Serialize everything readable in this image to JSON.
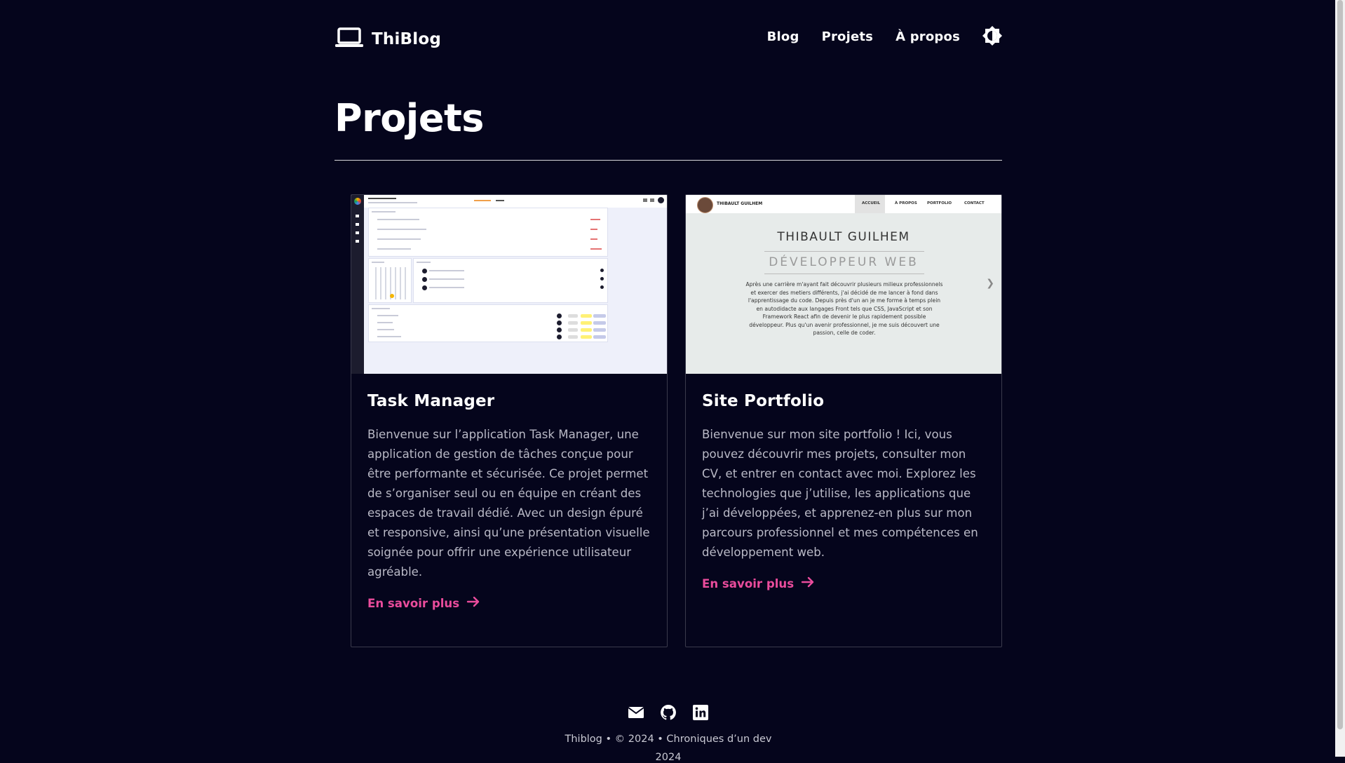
{
  "header": {
    "brand": "ThiBlog",
    "nav": [
      "Blog",
      "Projets",
      "À propos"
    ]
  },
  "page": {
    "title": "Projets"
  },
  "projects": [
    {
      "title": "Task Manager",
      "description": "Bienvenue sur l’application Task Manager, une application de gestion de tâches conçue pour être performante et sécurisée. Ce projet permet de s’organiser seul ou en équipe en créant des espaces de travail dédié. Avec un design épuré et responsive, ainsi qu’une présentation visuelle soignée pour offrir une expérience utilisateur agréable.",
      "link": "En savoir plus"
    },
    {
      "title": "Site Portfolio",
      "description": "Bienvenue sur mon site portfolio ! Ici, vous pouvez découvrir mes projets, consulter mon CV, et entrer en contact avec moi. Explorez les technologies que j’utilise, les applications que j’ai développées, et apprenez-en plus sur mon parcours professionnel et mes compétences en développement web.",
      "link": "En savoir plus"
    }
  ],
  "thumbs": {
    "portfolio": {
      "nav_name": "THIBAULT GUILHEM",
      "menu": [
        "ACCUEIL",
        "À PROPOS",
        "PORTFOLIO",
        "CONTACT"
      ],
      "heading": "THIBAULT GUILHEM",
      "subheading": "DÉVELOPPEUR WEB",
      "intro": "Après une carrière m'ayant fait découvrir plusieurs milieux professionnels et exercer des metiers différents, j'ai décidé de me lancer à fond dans l'apprentissage du code. Depuis près d'un an je me forme à temps plein en autodidacte aux langages Front tels que CSS, JavaScript et son Framework React afin de devenir le plus rapidement possible développeur. Plus qu'un avenir professionnel, je me suis découvert une passion, celle de coder."
    }
  },
  "footer": {
    "icons": [
      "mail-icon",
      "github-icon",
      "linkedin-icon"
    ],
    "copyright": "Thiblog • © 2024 • Chroniques d’un dev",
    "copyright_cut": "2024"
  },
  "colors": {
    "background": "#05051c",
    "accent": "#ea4c9c",
    "text": "#ffffff",
    "muted": "#b9b9c6"
  }
}
